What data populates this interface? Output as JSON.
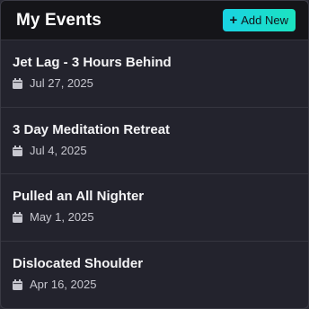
{
  "header": {
    "title": "My Events",
    "add_button": {
      "icon": "plus-icon",
      "label": "Add New"
    }
  },
  "events": [
    {
      "title": "Jet Lag - 3 Hours Behind",
      "date": "Jul 27, 2025",
      "icon": "calendar-icon"
    },
    {
      "title": "3 Day Meditation Retreat",
      "date": "Jul 4, 2025",
      "icon": "calendar-icon"
    },
    {
      "title": "Pulled an All Nighter",
      "date": "May 1, 2025",
      "icon": "calendar-icon"
    },
    {
      "title": "Dislocated Shoulder",
      "date": "Apr 16, 2025",
      "icon": "calendar-icon"
    }
  ],
  "colors": {
    "accent_start": "#19d2e3",
    "accent_end": "#1be3c0",
    "background": "#23232d",
    "header_background": "#151519"
  }
}
